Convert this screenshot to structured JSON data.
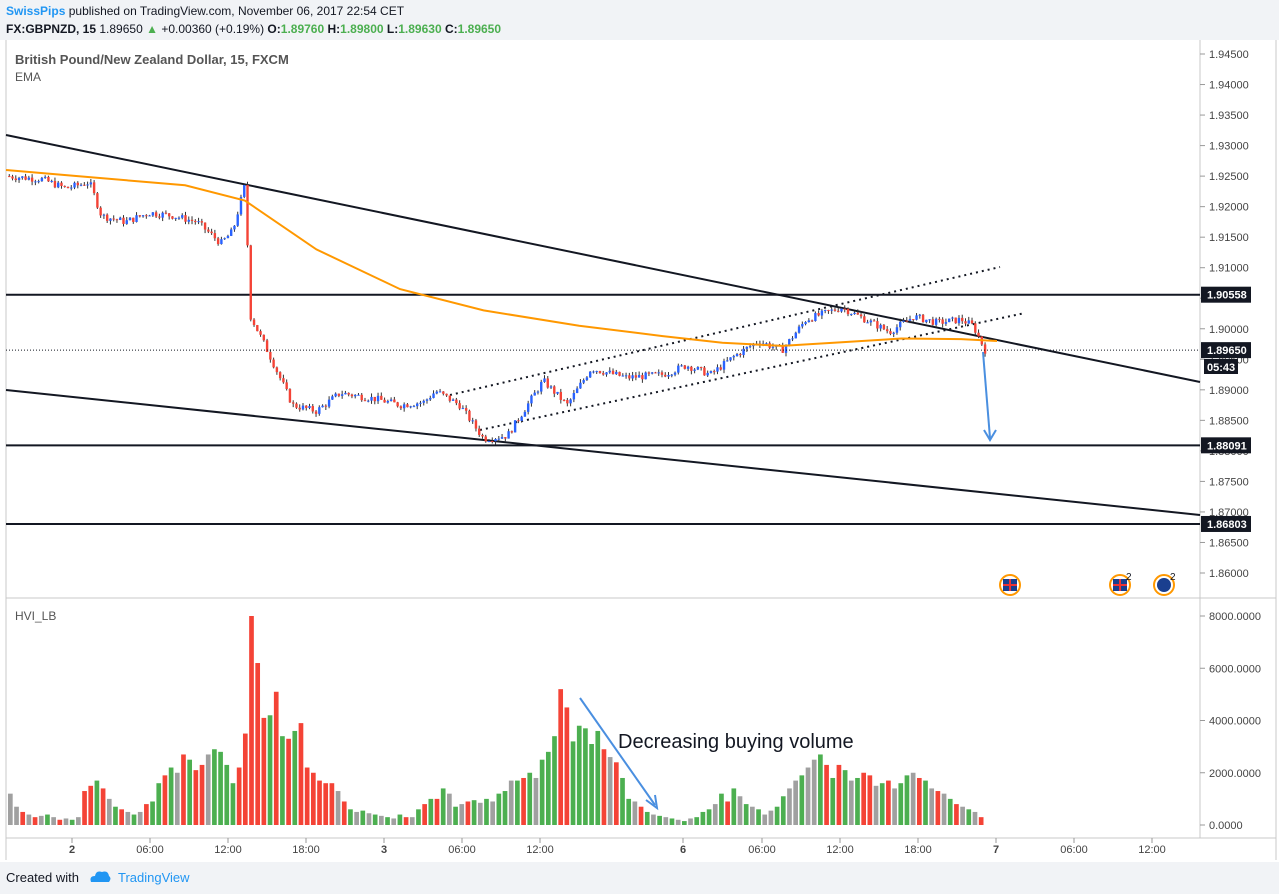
{
  "header": {
    "author": "SwissPips",
    "published": "published on TradingView.com, November 06, 2017 22:54 CET",
    "symbol": "FX:GBPNZD, 15",
    "last": "1.89650",
    "change": "+0.00360 (+0.19%)",
    "o_label": "O:",
    "o": "1.89760",
    "h_label": "H:",
    "h": "1.89800",
    "l_label": "L:",
    "l": "1.89630",
    "c_label": "C:",
    "c": "1.89650"
  },
  "legend": {
    "title": "British Pound/New Zealand Dollar, 15, FXCM",
    "ema": "EMA",
    "volume_indicator": "HVI_LB"
  },
  "annotations": {
    "volume_note": "Decreasing buying volume",
    "countdown": "05:43"
  },
  "footer": {
    "created_with": "Created with",
    "brand": "TradingView"
  },
  "colors": {
    "up": "#2962ff",
    "down": "#f44336",
    "ema": "#ff9800",
    "vol_up": "#4caf50",
    "vol_down": "#f44336",
    "vol_neutral": "#a0a0a0",
    "arrow": "#4a8fe0"
  },
  "chart_data": [
    {
      "type": "candlestick",
      "title": "British Pound/New Zealand Dollar, 15, FXCM",
      "ylim": [
        1.855,
        1.947
      ],
      "y_ticks": [
        "1.94500",
        "1.94000",
        "1.93500",
        "1.93000",
        "1.92500",
        "1.92000",
        "1.91500",
        "1.91000",
        "1.90500",
        "1.90000",
        "1.89500",
        "1.89000",
        "1.88500",
        "1.88000",
        "1.87500",
        "1.87000",
        "1.86500",
        "1.86000"
      ],
      "x_ticks": [
        "2",
        "06:00",
        "12:00",
        "18:00",
        "3",
        "06:00",
        "12:00",
        "6",
        "06:00",
        "12:00",
        "18:00",
        "7",
        "06:00",
        "12:00"
      ],
      "x_ticks_bold": [
        "2",
        "3",
        "6",
        "7"
      ],
      "price_labels": [
        {
          "label": "1.90558",
          "value": 1.90558
        },
        {
          "label": "1.89650",
          "value": 1.8965
        },
        {
          "label": "1.88091",
          "value": 1.88091
        },
        {
          "label": "1.86803",
          "value": 1.86803
        }
      ],
      "horizontal_levels": [
        1.90558,
        1.88091,
        1.86803
      ],
      "last_price": 1.8965,
      "ema_path": [
        [
          0,
          1.926
        ],
        [
          0.06,
          1.925
        ],
        [
          0.15,
          1.9235
        ],
        [
          0.2,
          1.921
        ],
        [
          0.26,
          1.913
        ],
        [
          0.33,
          1.9065
        ],
        [
          0.4,
          1.903
        ],
        [
          0.48,
          1.9005
        ],
        [
          0.55,
          1.8988
        ],
        [
          0.6,
          1.8977
        ],
        [
          0.65,
          1.8972
        ],
        [
          0.7,
          1.8978
        ],
        [
          0.75,
          1.8984
        ],
        [
          0.8,
          1.8983
        ],
        [
          0.83,
          1.898
        ]
      ],
      "price_path": [
        [
          0,
          1.925
        ],
        [
          0.03,
          1.9245
        ],
        [
          0.05,
          1.923
        ],
        [
          0.07,
          1.924
        ],
        [
          0.08,
          1.9185
        ],
        [
          0.1,
          1.9175
        ],
        [
          0.12,
          1.919
        ],
        [
          0.14,
          1.9185
        ],
        [
          0.16,
          1.9175
        ],
        [
          0.18,
          1.914
        ],
        [
          0.19,
          1.916
        ],
        [
          0.2,
          1.9235
        ],
        [
          0.205,
          1.902
        ],
        [
          0.22,
          1.896
        ],
        [
          0.24,
          1.8875
        ],
        [
          0.26,
          1.8865
        ],
        [
          0.28,
          1.8895
        ],
        [
          0.31,
          1.8885
        ],
        [
          0.33,
          1.8875
        ],
        [
          0.35,
          1.888
        ],
        [
          0.36,
          1.8898
        ],
        [
          0.38,
          1.8875
        ],
        [
          0.4,
          1.882
        ],
        [
          0.42,
          1.8825
        ],
        [
          0.43,
          1.8855
        ],
        [
          0.45,
          1.8915
        ],
        [
          0.47,
          1.8875
        ],
        [
          0.49,
          1.8935
        ],
        [
          0.52,
          1.892
        ],
        [
          0.55,
          1.8925
        ],
        [
          0.57,
          1.894
        ],
        [
          0.59,
          1.8925
        ],
        [
          0.61,
          1.8955
        ],
        [
          0.63,
          1.898
        ],
        [
          0.65,
          1.8965
        ],
        [
          0.67,
          1.9015
        ],
        [
          0.7,
          1.9035
        ],
        [
          0.72,
          1.9015
        ],
        [
          0.74,
          1.8995
        ],
        [
          0.76,
          1.902
        ],
        [
          0.78,
          1.901
        ],
        [
          0.8,
          1.9015
        ],
        [
          0.81,
          1.9005
        ],
        [
          0.82,
          1.8965
        ]
      ]
    },
    {
      "type": "bar",
      "title": "HVI_LB",
      "ylim": [
        -700,
        8500
      ],
      "y_ticks": [
        "8000.0000",
        "6000.0000",
        "4000.0000",
        "2000.0000",
        "0.0000"
      ],
      "values": [
        1200,
        700,
        500,
        400,
        300,
        350,
        400,
        300,
        200,
        250,
        200,
        300,
        1300,
        1500,
        1700,
        1400,
        1000,
        700,
        600,
        500,
        400,
        500,
        800,
        900,
        1600,
        1900,
        2200,
        2000,
        2700,
        2500,
        2100,
        2300,
        2700,
        2900,
        2800,
        2300,
        1600,
        2200,
        3500,
        8000,
        6200,
        4100,
        4200,
        5100,
        3400,
        3300,
        3600,
        3900,
        2200,
        2000,
        1700,
        1600,
        1600,
        1300,
        900,
        600,
        500,
        550,
        450,
        400,
        350,
        300,
        250,
        400,
        300,
        300,
        600,
        800,
        1000,
        1000,
        1400,
        1200,
        700,
        800,
        900,
        950,
        850,
        1000,
        900,
        1200,
        1300,
        1700,
        1700,
        1800,
        2000,
        1800,
        2500,
        2800,
        3400,
        5200,
        4500,
        3200,
        3800,
        3700,
        3100,
        3600,
        2900,
        2600,
        2400,
        1800,
        1000,
        900,
        700,
        500,
        400,
        350,
        300,
        250,
        200,
        150,
        250,
        300,
        500,
        600,
        800,
        1200,
        900,
        1400,
        1100,
        800,
        700,
        600,
        400,
        550,
        700,
        1100,
        1400,
        1700,
        1900,
        2200,
        2500,
        2700,
        2300,
        1800,
        2300,
        2100,
        1700,
        1800,
        2000,
        1900,
        1500,
        1600,
        1700,
        1400,
        1600,
        1900,
        2000,
        1800,
        1700,
        1400,
        1300,
        1200,
        1000,
        800,
        700,
        600,
        500,
        300
      ],
      "colors": [
        "n",
        "n",
        "r",
        "n",
        "r",
        "n",
        "g",
        "n",
        "r",
        "n",
        "g",
        "n",
        "r",
        "r",
        "g",
        "r",
        "n",
        "g",
        "r",
        "n",
        "g",
        "n",
        "r",
        "g",
        "g",
        "r",
        "g",
        "n",
        "r",
        "g",
        "r",
        "r",
        "n",
        "g",
        "g",
        "g",
        "g",
        "r",
        "r",
        "r",
        "r",
        "r",
        "g",
        "r",
        "g",
        "r",
        "g",
        "r",
        "r",
        "r",
        "r",
        "r",
        "r",
        "n",
        "r",
        "g",
        "n",
        "g",
        "n",
        "g",
        "n",
        "g",
        "n",
        "g",
        "r",
        "n",
        "g",
        "r",
        "g",
        "r",
        "g",
        "n",
        "g",
        "n",
        "r",
        "g",
        "n",
        "g",
        "n",
        "g",
        "g",
        "n",
        "g",
        "r",
        "g",
        "n",
        "g",
        "g",
        "g",
        "r",
        "r",
        "g",
        "g",
        "g",
        "g",
        "g",
        "r",
        "n",
        "r",
        "g",
        "g",
        "n",
        "r",
        "g",
        "n",
        "g",
        "n",
        "g",
        "n",
        "g",
        "n",
        "g",
        "g",
        "g",
        "n",
        "g",
        "r",
        "g",
        "n",
        "g",
        "n",
        "g",
        "n",
        "n",
        "g",
        "g",
        "n",
        "n",
        "g",
        "n",
        "n",
        "g",
        "r",
        "g",
        "r",
        "g",
        "n",
        "g",
        "r",
        "r",
        "n",
        "g",
        "r",
        "n",
        "g",
        "g",
        "n",
        "r",
        "g",
        "n",
        "r",
        "n",
        "g",
        "r",
        "n",
        "g",
        "n",
        "r",
        "n"
      ]
    }
  ]
}
